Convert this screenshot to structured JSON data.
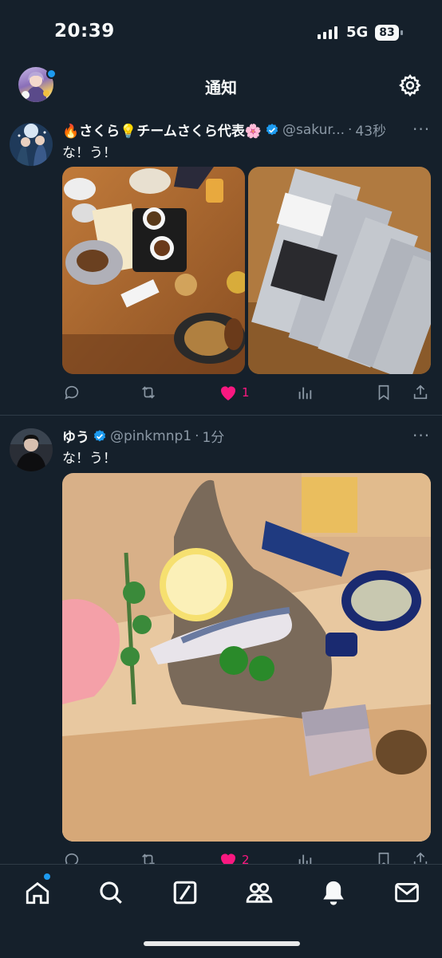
{
  "status_bar": {
    "time": "20:39",
    "network": "5G",
    "battery": "83"
  },
  "header": {
    "title": "通知",
    "settings_icon": "gear-icon"
  },
  "posts": [
    {
      "display_name": "🔥さくら💡チームさくら代表🌸",
      "handle": "@sakur...",
      "time": "43秒",
      "text": "な！う！",
      "likes": "1",
      "images": [
        "restaurant-table-photo",
        "cocos-packages-photo"
      ]
    },
    {
      "display_name": "ゆう",
      "handle": "@pinkmnp1",
      "time": "1分",
      "text": "な！う！",
      "likes": "2",
      "images": [
        "sashimi-plate-photo"
      ]
    }
  ],
  "colors": {
    "background": "#15202b",
    "accent": "#1d9bf0",
    "like": "#f91880",
    "muted": "#8b98a5"
  },
  "tabs": [
    "home-icon",
    "search-icon",
    "grok-icon",
    "communities-icon",
    "notifications-icon",
    "messages-icon"
  ]
}
